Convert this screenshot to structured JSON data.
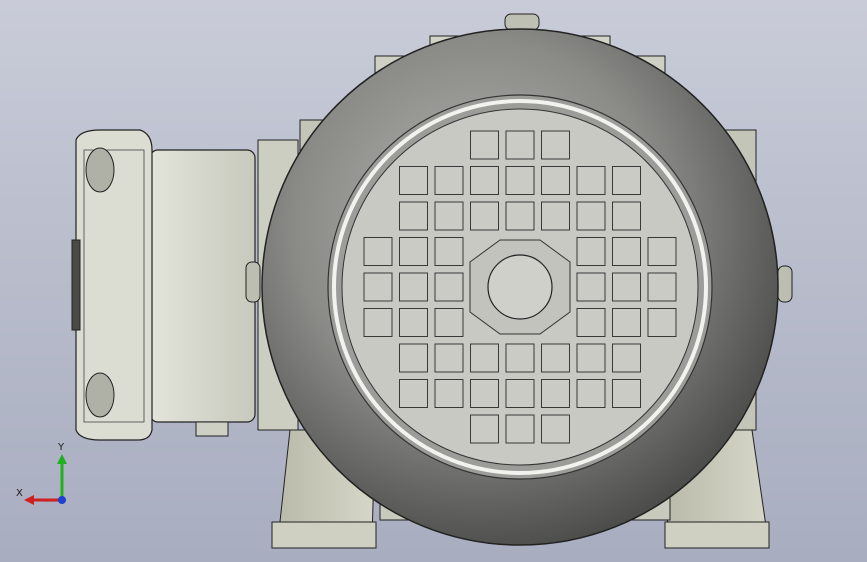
{
  "viewport": {
    "background_top": "#c9ccd8",
    "background_bottom": "#a8adc0"
  },
  "model": {
    "body_color": "#d7d8cc",
    "fan_cover_color": "#8a8b87",
    "grille_color": "#c8c9c3"
  },
  "triad": {
    "x_label": "X",
    "y_label": "Y",
    "x_color": "#d22020",
    "y_color": "#20b020",
    "z_color": "#2040d0"
  }
}
